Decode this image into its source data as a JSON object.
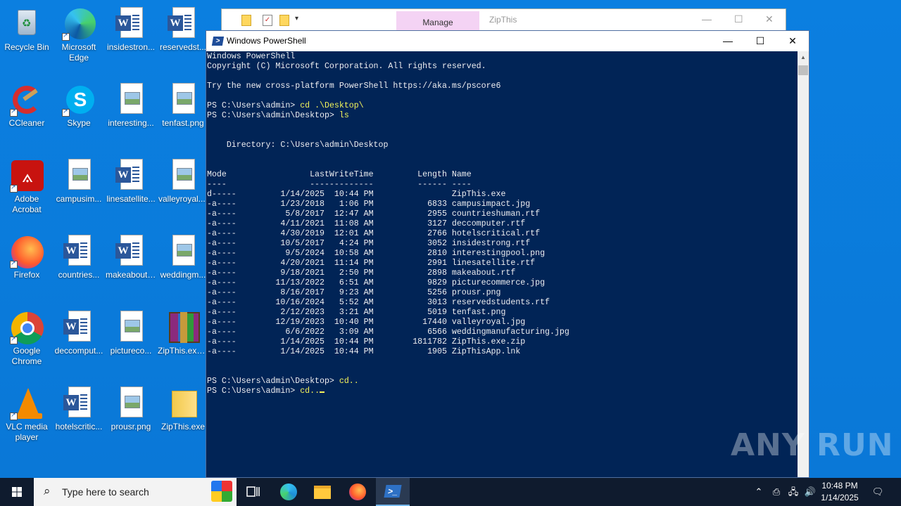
{
  "desktop_icons": [
    {
      "label": "Recycle Bin",
      "icon": "recycle-bin-icon"
    },
    {
      "label": "Microsoft Edge",
      "icon": "edge-icon"
    },
    {
      "label": "insidestron...",
      "icon": "word-doc-icon"
    },
    {
      "label": "reservedst...",
      "icon": "word-doc-icon"
    },
    {
      "label": "CCleaner",
      "icon": "ccleaner-icon"
    },
    {
      "label": "Skype",
      "icon": "skype-icon"
    },
    {
      "label": "interesting...",
      "icon": "image-file-icon"
    },
    {
      "label": "tenfast.png",
      "icon": "image-file-icon"
    },
    {
      "label": "Adobe Acrobat",
      "icon": "acrobat-icon"
    },
    {
      "label": "campusim...",
      "icon": "image-file-icon"
    },
    {
      "label": "linesatellite...",
      "icon": "word-doc-icon"
    },
    {
      "label": "valleyroyal....",
      "icon": "image-file-icon"
    },
    {
      "label": "Firefox",
      "icon": "firefox-icon"
    },
    {
      "label": "countries...",
      "icon": "word-doc-icon"
    },
    {
      "label": "makeabout....",
      "icon": "word-doc-icon"
    },
    {
      "label": "weddingm...",
      "icon": "image-file-icon"
    },
    {
      "label": "Google Chrome",
      "icon": "chrome-icon"
    },
    {
      "label": "deccomput...",
      "icon": "word-doc-icon"
    },
    {
      "label": "pictureco...",
      "icon": "image-file-icon"
    },
    {
      "label": "ZipThis.exe...",
      "icon": "winrar-icon"
    },
    {
      "label": "VLC media player",
      "icon": "vlc-icon"
    },
    {
      "label": "hotelscritic...",
      "icon": "word-doc-icon"
    },
    {
      "label": "prousr.png",
      "icon": "image-file-icon"
    },
    {
      "label": "ZipThis.exe",
      "icon": "folder-icon"
    }
  ],
  "explorer": {
    "manage_tab": "Manage",
    "title": "ZipThis"
  },
  "powershell": {
    "window_title": "Windows PowerShell",
    "lines": [
      "Windows PowerShell",
      "Copyright (C) Microsoft Corporation. All rights reserved.",
      "",
      "Try the new cross-platform PowerShell https://aka.ms/pscore6",
      "",
      "PS C:\\Users\\admin> |cd .\\Desktop\\",
      "PS C:\\Users\\admin\\Desktop> |ls",
      "",
      "",
      "    Directory: C:\\Users\\admin\\Desktop",
      "",
      "",
      "Mode                 LastWriteTime         Length Name",
      "----                 -------------         ------ ----",
      "d-----         1/14/2025  10:44 PM                ZipThis.exe",
      "-a----         1/23/2018   1:06 PM           6833 campusimpact.jpg",
      "-a----          5/8/2017  12:47 AM           2955 countrieshuman.rtf",
      "-a----         4/11/2021  11:08 AM           3127 deccomputer.rtf",
      "-a----         4/30/2019  12:01 AM           2766 hotelscritical.rtf",
      "-a----         10/5/2017   4:24 PM           3052 insidestrong.rtf",
      "-a----          9/5/2024  10:58 AM           2810 interestingpool.png",
      "-a----         4/20/2021  11:14 PM           2991 linesatellite.rtf",
      "-a----         9/18/2021   2:50 PM           2898 makeabout.rtf",
      "-a----        11/13/2022   6:51 AM           9829 picturecommerce.jpg",
      "-a----         8/16/2017   9:23 AM           5256 prousr.png",
      "-a----        10/16/2024   5:52 AM           3013 reservedstudents.rtf",
      "-a----         2/12/2023   3:21 AM           5019 tenfast.png",
      "-a----        12/19/2023  10:40 PM          17440 valleyroyal.jpg",
      "-a----          6/6/2022   3:09 AM           6566 weddingmanufacturing.jpg",
      "-a----         1/14/2025  10:44 PM        1811782 ZipThis.exe.zip",
      "-a----         1/14/2025  10:44 PM           1905 ZipThisApp.lnk",
      "",
      "",
      "PS C:\\Users\\admin\\Desktop> |cd..",
      "PS C:\\Users\\admin> |cd.."
    ]
  },
  "watermark": "ANY RUN",
  "taskbar": {
    "search_placeholder": "Type here to search",
    "time": "10:48 PM",
    "date": "1/14/2025"
  },
  "colors": {
    "desktop": "#0a78d7",
    "powershell_bg": "#012456",
    "powershell_text": "#eeedf0",
    "command_text": "#f2f25a"
  }
}
